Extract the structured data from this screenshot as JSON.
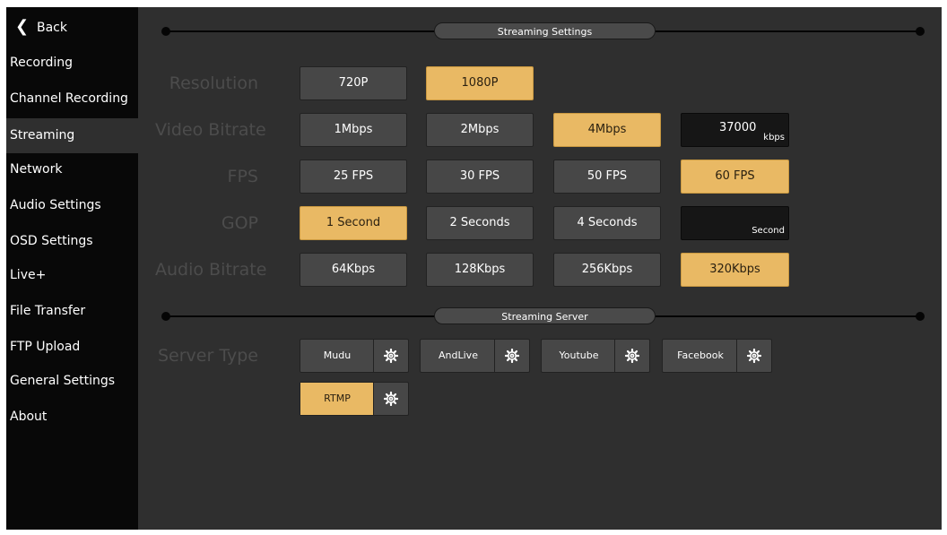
{
  "sidebar": {
    "back_label": "Back",
    "back_icon": "chevron-left-icon",
    "items": [
      {
        "label": "Recording"
      },
      {
        "label": "Channel Recording"
      },
      {
        "label": "Streaming",
        "active": true
      },
      {
        "label": "Network"
      },
      {
        "label": "Audio Settings"
      },
      {
        "label": "OSD Settings"
      },
      {
        "label": "Live+"
      },
      {
        "label": "File Transfer"
      },
      {
        "label": "FTP Upload"
      },
      {
        "label": "General Settings"
      },
      {
        "label": "About"
      }
    ]
  },
  "streaming_settings": {
    "title": "Streaming Settings",
    "resolution": {
      "label": "Resolution",
      "options": [
        "720P",
        "1080P"
      ],
      "selected": "1080P"
    },
    "video_bitrate": {
      "label": "Video Bitrate",
      "options": [
        "1Mbps",
        "2Mbps",
        "4Mbps"
      ],
      "selected": "4Mbps",
      "custom_value": "37000",
      "custom_unit": "kbps"
    },
    "fps": {
      "label": "FPS",
      "options": [
        "25 FPS",
        "30 FPS",
        "50 FPS",
        "60 FPS"
      ],
      "selected": "60 FPS"
    },
    "gop": {
      "label": "GOP",
      "options": [
        "1 Second",
        "2 Seconds",
        "4 Seconds"
      ],
      "selected": "1 Second",
      "custom_value": "",
      "custom_unit": "Second"
    },
    "audio_bitrate": {
      "label": "Audio Bitrate",
      "options": [
        "64Kbps",
        "128Kbps",
        "256Kbps",
        "320Kbps"
      ],
      "selected": "320Kbps"
    }
  },
  "streaming_server": {
    "title": "Streaming Server",
    "server_type_label": "Server Type",
    "servers": [
      "Mudu",
      "AndLive",
      "Youtube",
      "Facebook",
      "RTMP"
    ],
    "selected": "RTMP",
    "gear_icon": "gear-icon"
  },
  "colors": {
    "accent": "#e9b964",
    "sidebar_bg": "#080808",
    "panel_bg": "#2f2f2f",
    "button_bg": "#474747",
    "label_dim": "#4c4c4c"
  }
}
